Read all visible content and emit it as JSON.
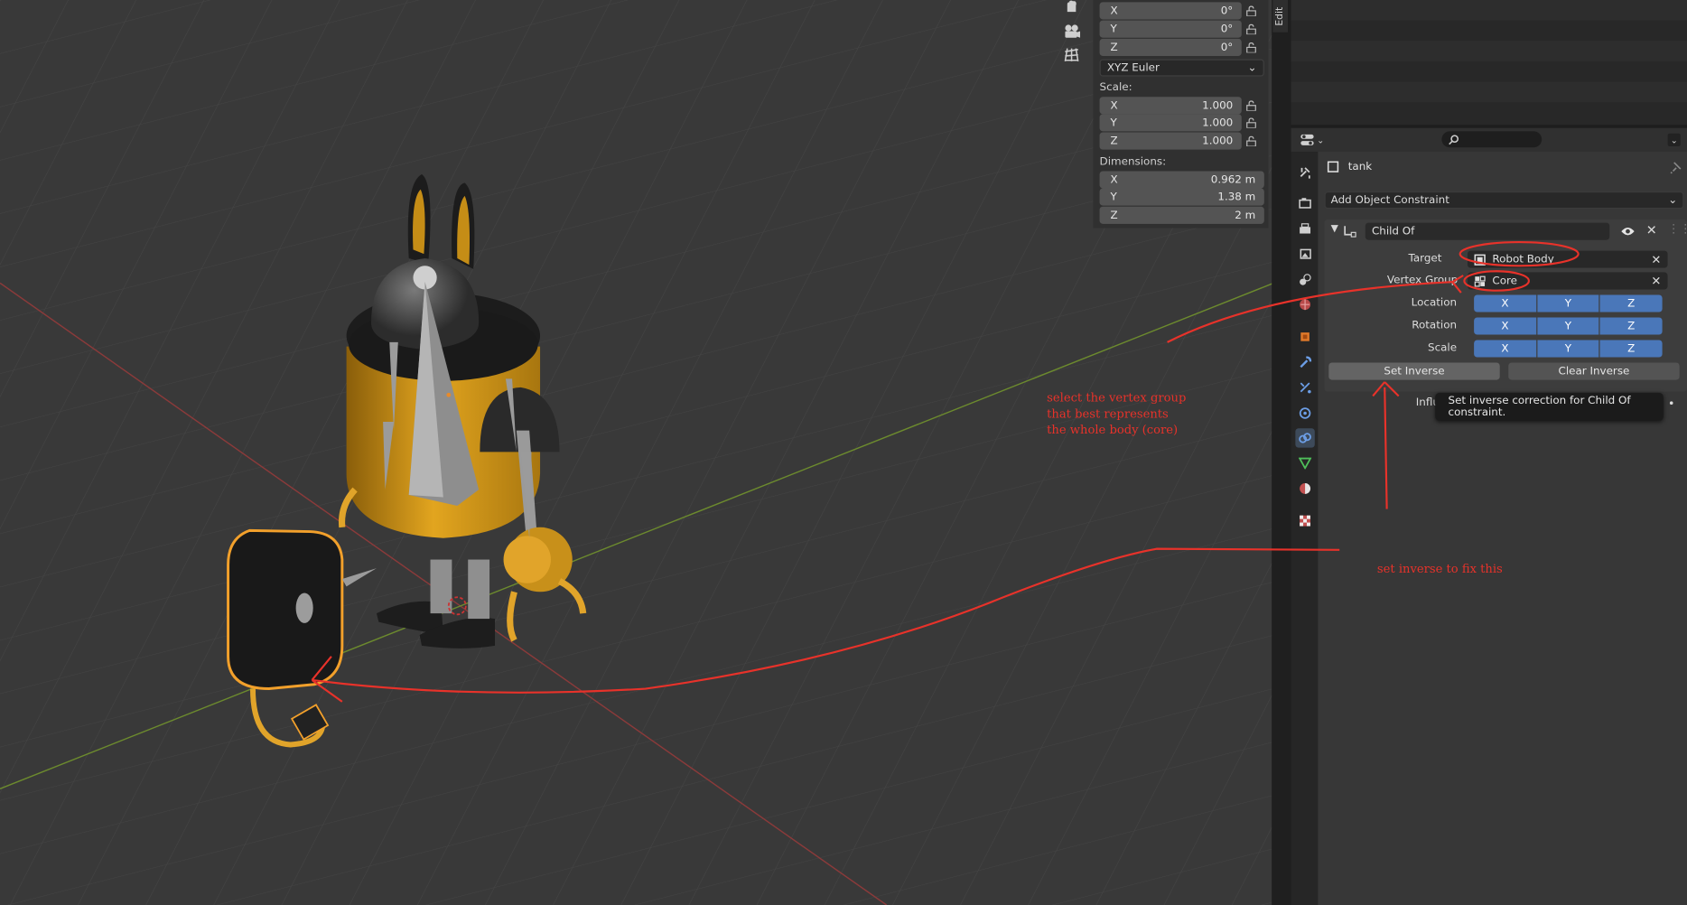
{
  "viewport": {
    "tools": [
      {
        "icon": "hand-pan-icon"
      },
      {
        "icon": "camera-view-icon"
      },
      {
        "icon": "grid-ortho-icon"
      }
    ]
  },
  "npanel": {
    "rotation": [
      {
        "axis": "X",
        "value": "0°"
      },
      {
        "axis": "Y",
        "value": "0°"
      },
      {
        "axis": "Z",
        "value": "0°"
      }
    ],
    "rotation_mode": "XYZ Euler",
    "scale_label": "Scale:",
    "scale": [
      {
        "axis": "X",
        "value": "1.000"
      },
      {
        "axis": "Y",
        "value": "1.000"
      },
      {
        "axis": "Z",
        "value": "1.000"
      }
    ],
    "dimensions_label": "Dimensions:",
    "dimensions": [
      {
        "axis": "X",
        "value": "0.962 m"
      },
      {
        "axis": "Y",
        "value": "1.38 m"
      },
      {
        "axis": "Z",
        "value": "2 m"
      }
    ]
  },
  "sidebar_tab": "Edit",
  "properties": {
    "object_name": "tank",
    "add_constraint": "Add Object Constraint",
    "constraint": {
      "name": "Child Of",
      "target_label": "Target",
      "target_value": "Robot Body",
      "vertex_group_label": "Vertex Group",
      "vertex_group_value": "Core",
      "location_label": "Location",
      "rotation_label": "Rotation",
      "scale_label": "Scale",
      "axes": [
        "X",
        "Y",
        "Z"
      ],
      "set_inverse": "Set Inverse",
      "clear_inverse": "Clear Inverse",
      "influence_label": "Influ"
    },
    "tooltip": "Set inverse correction for Child Of constraint.",
    "tabs": [
      "tool-icon",
      "render-icon",
      "output-icon",
      "view-layer-icon",
      "scene-icon",
      "world-icon",
      "object-icon",
      "modifier-icon",
      "particles-icon",
      "physics-icon",
      "constraint-icon",
      "data-icon",
      "material-icon",
      "texture-icon"
    ]
  },
  "annotations": {
    "vertex_group_note": "select the vertex group\nthat best represents\nthe whole body (core)",
    "set_inverse_note": "set inverse to fix this",
    "color": "#e8322a"
  },
  "colors": {
    "accent": "#4a77b9",
    "robot_yellow": "#e0a21c",
    "selection_outline": "#f2a02b"
  }
}
